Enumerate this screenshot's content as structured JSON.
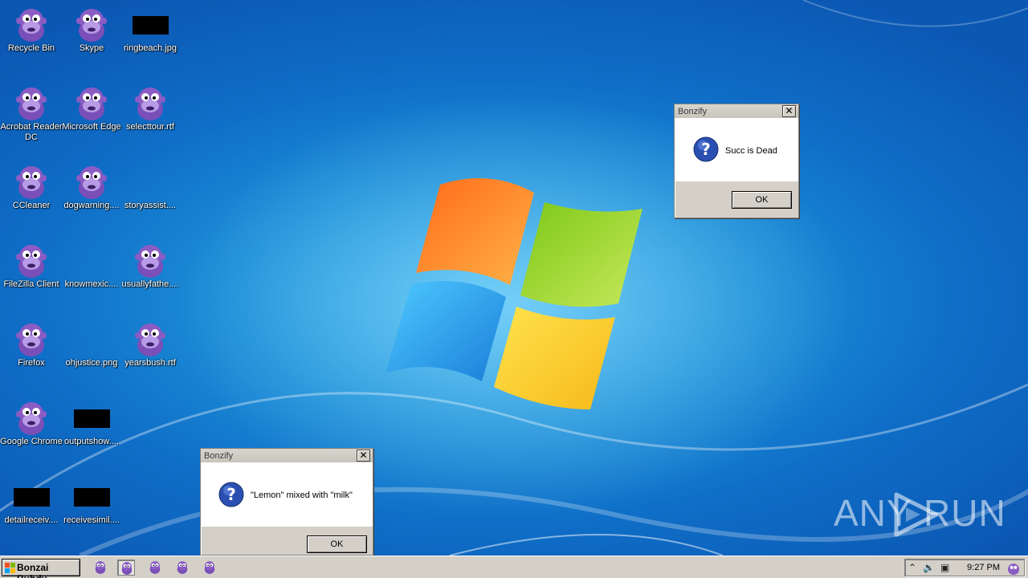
{
  "desktop_icons": [
    {
      "label": "Recycle Bin",
      "type": "bonzi"
    },
    {
      "label": "Skype",
      "type": "bonzi"
    },
    {
      "label": "ringbeach.jpg",
      "type": "black"
    },
    {
      "label": "Acrobat Reader DC",
      "type": "bonzi"
    },
    {
      "label": "Microsoft Edge",
      "type": "bonzi"
    },
    {
      "label": "selecttour.rtf",
      "type": "bonzi"
    },
    {
      "label": "CCleaner",
      "type": "bonzi"
    },
    {
      "label": "dogwarning....",
      "type": "bonzi"
    },
    {
      "label": "storyassist....",
      "type": "none"
    },
    {
      "label": "FileZilla Client",
      "type": "bonzi"
    },
    {
      "label": "knowmexic....",
      "type": "none"
    },
    {
      "label": "usuallyfathe....",
      "type": "bonzi"
    },
    {
      "label": "Firefox",
      "type": "bonzi"
    },
    {
      "label": "ohjustice.png",
      "type": "none"
    },
    {
      "label": "yearsbush.rtf",
      "type": "bonzi"
    },
    {
      "label": "Google Chrome",
      "type": "bonzi"
    },
    {
      "label": "outputshow....",
      "type": "black"
    },
    {
      "label": "detailreceiv....",
      "type": "black"
    },
    {
      "label": "receivesimil....",
      "type": "black"
    }
  ],
  "dialog1": {
    "title": "Bonzify",
    "message": "Succ is Dead",
    "ok_label": "OK"
  },
  "dialog2": {
    "title": "Bonzify",
    "message": "\"Lemon\" mixed with \"milk\"",
    "ok_label": "OK"
  },
  "taskbar": {
    "start_label": "Bonzai Buhdy",
    "clock": "9:27 PM"
  },
  "watermark": {
    "left": "ANY",
    "right": "RUN"
  },
  "colors": {
    "bonzi_purple": "#8a5cc4",
    "desktop_blue": "#1c8fd8",
    "dialog_gray": "#d4d0c8"
  }
}
